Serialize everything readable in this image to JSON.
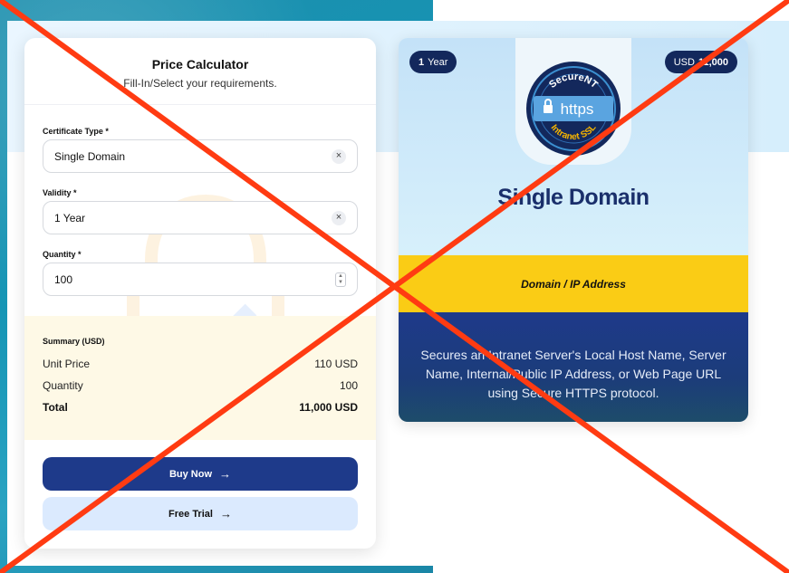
{
  "calculator": {
    "title": "Price Calculator",
    "subtitle": "Fill-In/Select your requirements.",
    "certificate_type": {
      "label": "Certificate Type *",
      "value": "Single Domain"
    },
    "validity": {
      "label": "Validity *",
      "value": "1 Year"
    },
    "quantity": {
      "label": "Quantity *",
      "value": "100"
    },
    "summary": {
      "title": "Summary (USD)",
      "unit_price_label": "Unit Price",
      "unit_price_value": "110 USD",
      "quantity_label": "Quantity",
      "quantity_value": "100",
      "total_label": "Total",
      "total_value": "11,000 USD"
    },
    "buy_label": "Buy Now",
    "trial_label": "Free Trial",
    "arrow": "→",
    "clear_glyph": "×"
  },
  "product": {
    "years_number": "1",
    "years_unit": "Year",
    "currency": "USD",
    "price": "11,000",
    "seal_top": "SecureNT",
    "seal_main": "https",
    "seal_bottom": "Intranet SSL",
    "name": "Single Domain",
    "field_label": "Domain / IP Address",
    "description": "Secures an Intranet Server's Local Host Name, Server Name, Internal/Public IP Address, or Web Page URL using Secure HTTPS protocol."
  },
  "colors": {
    "navy": "#1e3a8a",
    "badge_navy": "#13285c",
    "yellow": "#facc15",
    "summary_bg": "#fef9e6",
    "trial_bg": "#dbeafe",
    "cross_red": "#ff3b12"
  }
}
